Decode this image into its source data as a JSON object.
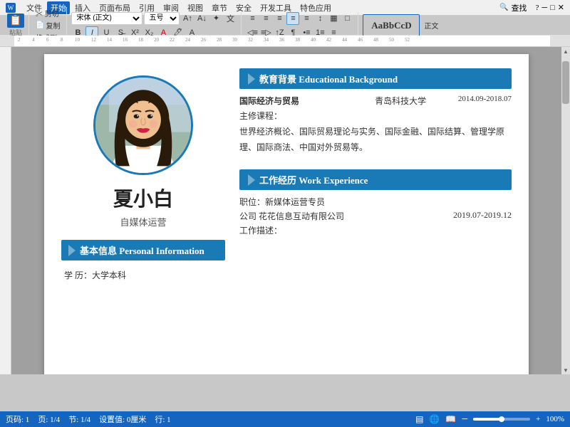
{
  "titleBar": {
    "appName": "文件",
    "menuItems": [
      "文件",
      "开始",
      "插入",
      "页面布局",
      "引用",
      "审阅",
      "视图",
      "章节",
      "安全",
      "开发工具",
      "特色应用"
    ],
    "activeMenu": "开始",
    "searchPlaceholder": "查找",
    "windowButtons": [
      "─",
      "□",
      "✕"
    ]
  },
  "toolbar": {
    "paste": "粘贴",
    "cut": "✂ 剪切",
    "copy": "复制",
    "formatPainter": "格式刷",
    "fontFamily": "宋体 (正文)",
    "fontSize": "五号",
    "bold": "B",
    "italic": "I",
    "underline": "U",
    "styleLabel": "正文",
    "styleText": "AaBbCcD"
  },
  "ruler": {
    "marks": [
      "2",
      "4",
      "6",
      "8",
      "10",
      "12",
      "14",
      "16",
      "18",
      "20",
      "22",
      "24",
      "26",
      "28",
      "30",
      "32",
      "34",
      "36",
      "38",
      "40",
      "42",
      "44",
      "46",
      "48",
      "50",
      "52"
    ]
  },
  "resume": {
    "name": "夏小白",
    "title": "自媒体运营",
    "personalInfoLabel": "基本信息 Personal Information",
    "eduLabel": "教育背景 Educational Background",
    "workLabel": "工作经历 Work Experience",
    "edu": {
      "major": "国际经济与贸易",
      "school": "青岛科技大学",
      "date": "2014.09-2018.07",
      "coursesLabel": "主修课程：",
      "courses": "世界经济概论、国际贸易理论与实务、国际金融、国际结算、管理学原理、国际商法、中国对外贸易等。"
    },
    "work": {
      "positionLabel": "职位：新媒体运营专员",
      "company": "公司 花花信息互动有限公司",
      "companyDate": "2019.07-2019.12",
      "descLabel": "工作描述："
    },
    "personalInfo": {
      "eduLevel": "学   历：大学本科"
    }
  },
  "statusBar": {
    "page": "页码: 1",
    "totalPages": "页: 1/4",
    "section": "节: 1/4",
    "settings": "设置值: 0厘米",
    "line": "行: 1",
    "zoomPercent": "100%"
  }
}
